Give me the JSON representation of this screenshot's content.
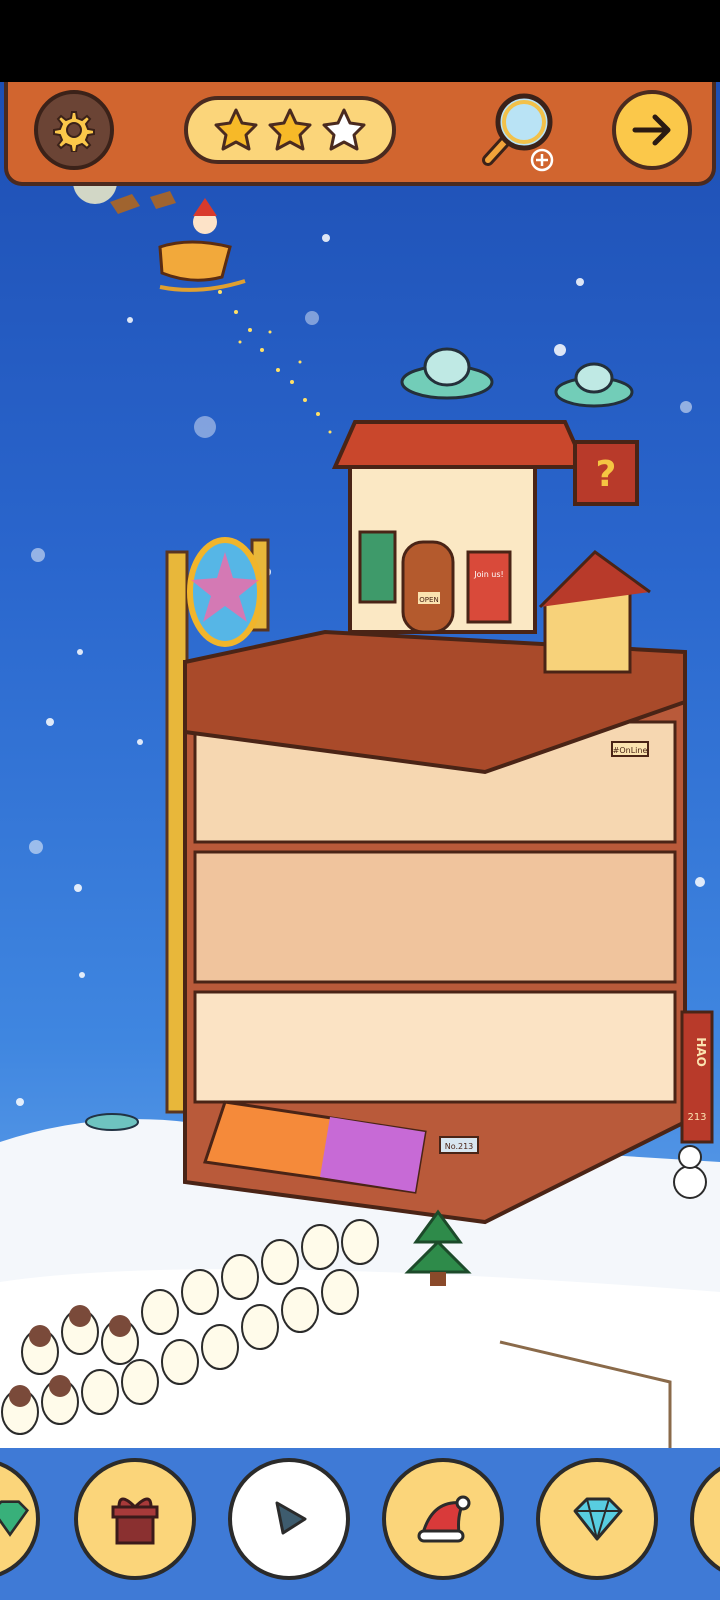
{
  "top_bar": {
    "settings_icon": "gear-icon",
    "stars_earned": 2,
    "stars_total": 3,
    "hint_icon": "magnifier-plus-icon",
    "next_icon": "arrow-right-icon"
  },
  "scene": {
    "question_sign": "?",
    "shop_sign": "OPEN",
    "join_sign": "Join us!",
    "online_sign": "#OnLine",
    "hao_sign": "HAO",
    "hao_number": "213",
    "door_number": "No.213"
  },
  "items": [
    {
      "icon": "diamond-icon",
      "found": false
    },
    {
      "icon": "gift-box-icon",
      "found": false
    },
    {
      "icon": "play-triangle-icon",
      "found": true
    },
    {
      "icon": "santa-hat-icon",
      "found": false
    },
    {
      "icon": "diamond-icon",
      "found": false
    },
    {
      "icon": "partial-item-icon",
      "found": false
    }
  ],
  "colors": {
    "top_bar": "#d1652f",
    "button_yellow": "#fbd57a",
    "item_bar": "#3f7ad6",
    "sky_top": "#1e4fb4"
  }
}
